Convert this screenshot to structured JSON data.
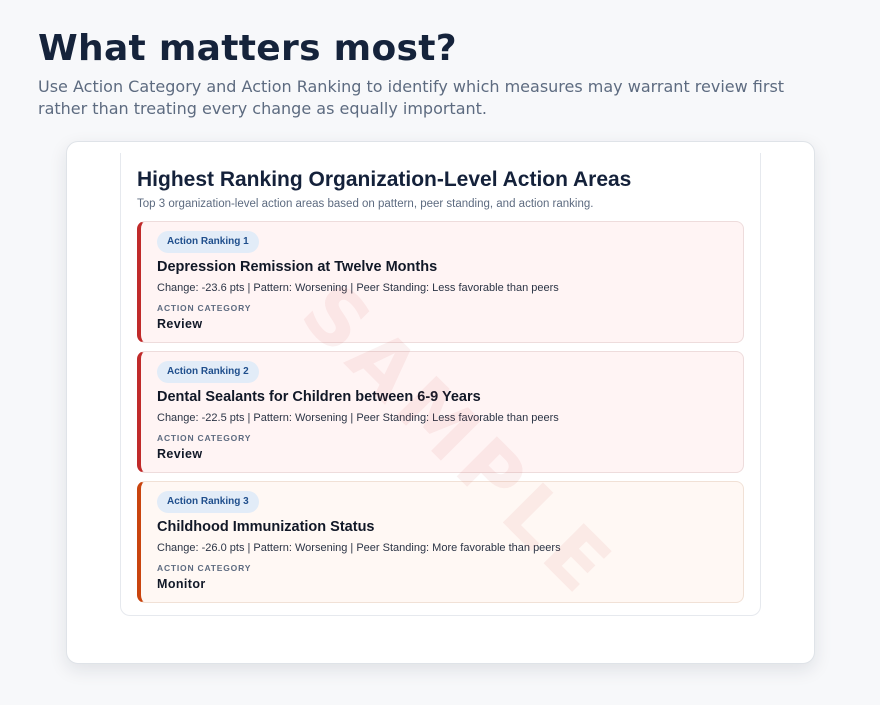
{
  "header": {
    "title": "What matters most?",
    "subtitle": "Use Action Category and Action Ranking to identify which measures may warrant review first rather than treating every change as equally important."
  },
  "panel": {
    "title": "Highest Ranking Organization-Level Action Areas",
    "subtitle": "Top 3 organization-level action areas based on pattern, peer standing, and action ranking.",
    "category_heading": "ACTION CATEGORY",
    "items": [
      {
        "rank_label": "Action Ranking 1",
        "measure": "Depression Remission at Twelve Months",
        "meta": "Change: -23.6 pts | Pattern: Worsening | Peer Standing: Less favorable than peers",
        "category": "Review"
      },
      {
        "rank_label": "Action Ranking 2",
        "measure": "Dental Sealants for Children between 6-9 Years",
        "meta": "Change: -22.5 pts | Pattern: Worsening | Peer Standing: Less favorable than peers",
        "category": "Review"
      },
      {
        "rank_label": "Action Ranking 3",
        "measure": "Childhood Immunization Status",
        "meta": "Change: -26.0 pts | Pattern: Worsening | Peer Standing: More favorable than peers",
        "category": "Monitor"
      }
    ]
  },
  "watermark": "SAMPLE",
  "colors": {
    "review_accent": "#c02a2a",
    "monitor_accent": "#c9440e",
    "badge_bg": "#e2ecf8",
    "badge_text": "#1f4e8c"
  }
}
